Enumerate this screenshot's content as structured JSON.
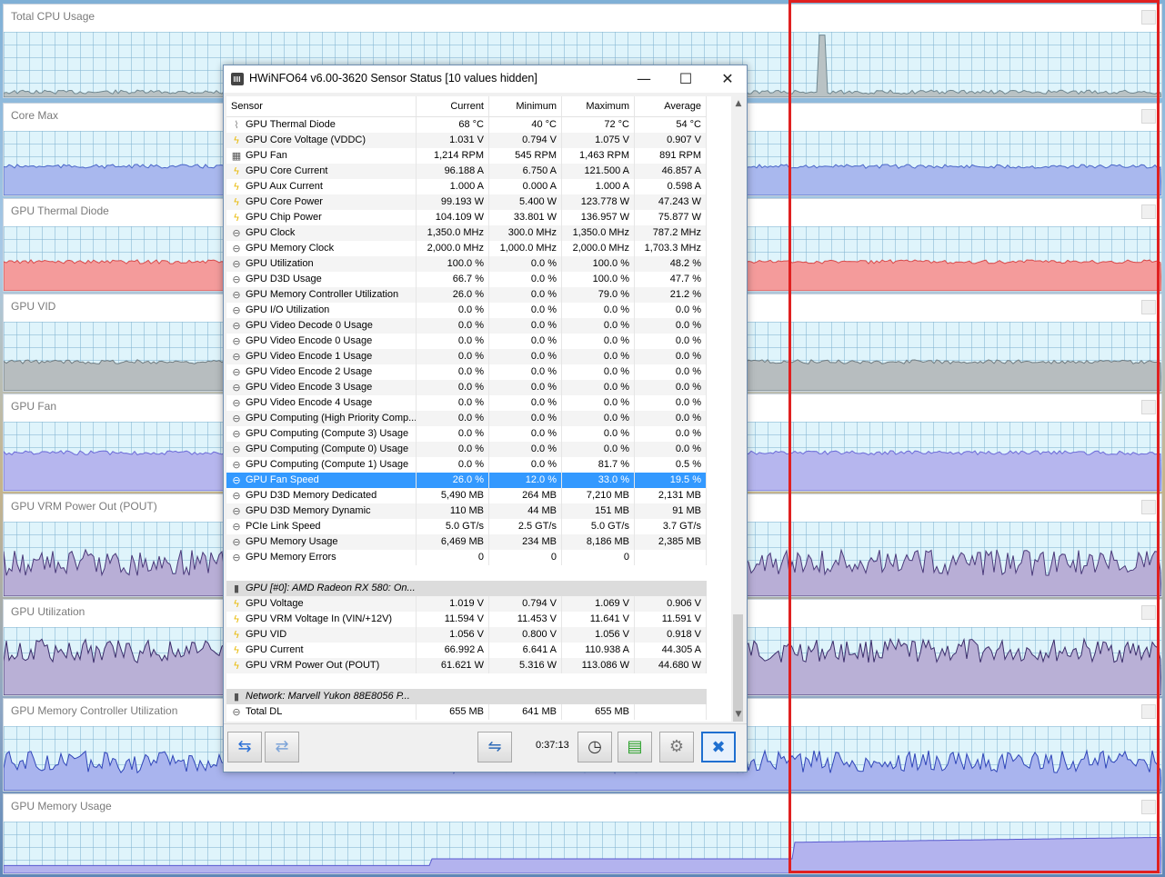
{
  "graphs": [
    {
      "title": "Total CPU Usage",
      "fill": "#b9c2c4",
      "line": "#6f8790"
    },
    {
      "title": "Core Max",
      "fill": "#a9b8ee",
      "line": "#4a67c9"
    },
    {
      "title": "GPU Thermal Diode",
      "fill": "#f49b9b",
      "line": "#d84a4a"
    },
    {
      "title": "GPU VID",
      "fill": "#b7bdbf",
      "line": "#6e7c82"
    },
    {
      "title": "GPU Fan",
      "fill": "#b6b6ee",
      "line": "#6a6ad8"
    },
    {
      "title": "GPU VRM Power Out (POUT)",
      "fill": "#b8aed6",
      "line": "#4a3a7a"
    },
    {
      "title": "GPU Utilization",
      "fill": "#b9b0d6",
      "line": "#3b2d6b"
    },
    {
      "title": "GPU Memory Controller Utilization",
      "fill": "#a9b4ee",
      "line": "#2f45b8"
    },
    {
      "title": "GPU Memory Usage",
      "fill": "#b3b3ee",
      "line": "#5a5ad0"
    }
  ],
  "window": {
    "title": "HWiNFO64 v6.00-3620 Sensor Status [10 values hidden]",
    "controls": {
      "minimize": "—",
      "maximize": "☐",
      "close": "✕"
    },
    "columns": {
      "sensor": "Sensor",
      "current": "Current",
      "minimum": "Minimum",
      "maximum": "Maximum",
      "average": "Average"
    },
    "rows": [
      {
        "icon": "thermo",
        "name": "GPU Thermal Diode",
        "cur": "68 °C",
        "min": "40 °C",
        "max": "72 °C",
        "avg": "54 °C"
      },
      {
        "icon": "bolt",
        "name": "GPU Core Voltage (VDDC)",
        "cur": "1.031 V",
        "min": "0.794 V",
        "max": "1.075 V",
        "avg": "0.907 V"
      },
      {
        "icon": "fan",
        "name": "GPU Fan",
        "cur": "1,214 RPM",
        "min": "545 RPM",
        "max": "1,463 RPM",
        "avg": "891 RPM"
      },
      {
        "icon": "bolt",
        "name": "GPU Core Current",
        "cur": "96.188 A",
        "min": "6.750 A",
        "max": "121.500 A",
        "avg": "46.857 A"
      },
      {
        "icon": "bolt",
        "name": "GPU Aux Current",
        "cur": "1.000 A",
        "min": "0.000 A",
        "max": "1.000 A",
        "avg": "0.598 A"
      },
      {
        "icon": "bolt",
        "name": "GPU Core Power",
        "cur": "99.193 W",
        "min": "5.400 W",
        "max": "123.778 W",
        "avg": "47.243 W"
      },
      {
        "icon": "bolt",
        "name": "GPU Chip Power",
        "cur": "104.109 W",
        "min": "33.801 W",
        "max": "136.957 W",
        "avg": "75.877 W"
      },
      {
        "icon": "clock",
        "name": "GPU Clock",
        "cur": "1,350.0 MHz",
        "min": "300.0 MHz",
        "max": "1,350.0 MHz",
        "avg": "787.2 MHz"
      },
      {
        "icon": "clock",
        "name": "GPU Memory Clock",
        "cur": "2,000.0 MHz",
        "min": "1,000.0 MHz",
        "max": "2,000.0 MHz",
        "avg": "1,703.3 MHz"
      },
      {
        "icon": "clock",
        "name": "GPU Utilization",
        "cur": "100.0 %",
        "min": "0.0 %",
        "max": "100.0 %",
        "avg": "48.2 %"
      },
      {
        "icon": "clock",
        "name": "GPU D3D Usage",
        "cur": "66.7 %",
        "min": "0.0 %",
        "max": "100.0 %",
        "avg": "47.7 %"
      },
      {
        "icon": "clock",
        "name": "GPU Memory Controller Utilization",
        "cur": "26.0 %",
        "min": "0.0 %",
        "max": "79.0 %",
        "avg": "21.2 %"
      },
      {
        "icon": "clock",
        "name": "GPU I/O Utilization",
        "cur": "0.0 %",
        "min": "0.0 %",
        "max": "0.0 %",
        "avg": "0.0 %"
      },
      {
        "icon": "clock",
        "name": "GPU Video Decode 0 Usage",
        "cur": "0.0 %",
        "min": "0.0 %",
        "max": "0.0 %",
        "avg": "0.0 %"
      },
      {
        "icon": "clock",
        "name": "GPU Video Encode 0 Usage",
        "cur": "0.0 %",
        "min": "0.0 %",
        "max": "0.0 %",
        "avg": "0.0 %"
      },
      {
        "icon": "clock",
        "name": "GPU Video Encode 1 Usage",
        "cur": "0.0 %",
        "min": "0.0 %",
        "max": "0.0 %",
        "avg": "0.0 %"
      },
      {
        "icon": "clock",
        "name": "GPU Video Encode 2 Usage",
        "cur": "0.0 %",
        "min": "0.0 %",
        "max": "0.0 %",
        "avg": "0.0 %"
      },
      {
        "icon": "clock",
        "name": "GPU Video Encode 3 Usage",
        "cur": "0.0 %",
        "min": "0.0 %",
        "max": "0.0 %",
        "avg": "0.0 %"
      },
      {
        "icon": "clock",
        "name": "GPU Video Encode 4 Usage",
        "cur": "0.0 %",
        "min": "0.0 %",
        "max": "0.0 %",
        "avg": "0.0 %"
      },
      {
        "icon": "clock",
        "name": "GPU Computing (High Priority Comp...",
        "cur": "0.0 %",
        "min": "0.0 %",
        "max": "0.0 %",
        "avg": "0.0 %"
      },
      {
        "icon": "clock",
        "name": "GPU Computing (Compute 3) Usage",
        "cur": "0.0 %",
        "min": "0.0 %",
        "max": "0.0 %",
        "avg": "0.0 %"
      },
      {
        "icon": "clock",
        "name": "GPU Computing (Compute 0) Usage",
        "cur": "0.0 %",
        "min": "0.0 %",
        "max": "0.0 %",
        "avg": "0.0 %"
      },
      {
        "icon": "clock",
        "name": "GPU Computing (Compute 1) Usage",
        "cur": "0.0 %",
        "min": "0.0 %",
        "max": "81.7 %",
        "avg": "0.5 %"
      },
      {
        "icon": "clock",
        "name": "GPU Fan Speed",
        "cur": "26.0 %",
        "min": "12.0 %",
        "max": "33.0 %",
        "avg": "19.5 %",
        "selected": true
      },
      {
        "icon": "clock",
        "name": "GPU D3D Memory Dedicated",
        "cur": "5,490 MB",
        "min": "264 MB",
        "max": "7,210 MB",
        "avg": "2,131 MB"
      },
      {
        "icon": "clock",
        "name": "GPU D3D Memory Dynamic",
        "cur": "110 MB",
        "min": "44 MB",
        "max": "151 MB",
        "avg": "91 MB"
      },
      {
        "icon": "clock",
        "name": "PCIe Link Speed",
        "cur": "5.0 GT/s",
        "min": "2.5 GT/s",
        "max": "5.0 GT/s",
        "avg": "3.7 GT/s"
      },
      {
        "icon": "clock",
        "name": "GPU Memory Usage",
        "cur": "6,469 MB",
        "min": "234 MB",
        "max": "8,186 MB",
        "avg": "2,385 MB"
      },
      {
        "icon": "clock",
        "name": "GPU Memory Errors",
        "cur": "0",
        "min": "0",
        "max": "0",
        "avg": ""
      },
      {
        "blank": true
      },
      {
        "icon": "chip",
        "name": "GPU [#0]: AMD Radeon RX 580: On...",
        "group": true
      },
      {
        "icon": "bolt",
        "name": "GPU Voltage",
        "cur": "1.019 V",
        "min": "0.794 V",
        "max": "1.069 V",
        "avg": "0.906 V"
      },
      {
        "icon": "bolt",
        "name": "GPU VRM Voltage In (VIN/+12V)",
        "cur": "11.594 V",
        "min": "11.453 V",
        "max": "11.641 V",
        "avg": "11.591 V"
      },
      {
        "icon": "bolt",
        "name": "GPU VID",
        "cur": "1.056 V",
        "min": "0.800 V",
        "max": "1.056 V",
        "avg": "0.918 V"
      },
      {
        "icon": "bolt",
        "name": "GPU Current",
        "cur": "66.992 A",
        "min": "6.641 A",
        "max": "110.938 A",
        "avg": "44.305 A"
      },
      {
        "icon": "bolt",
        "name": "GPU VRM Power Out (POUT)",
        "cur": "61.621 W",
        "min": "5.316 W",
        "max": "113.086 W",
        "avg": "44.680 W"
      },
      {
        "blank": true
      },
      {
        "icon": "chip",
        "name": "Network: Marvell Yukon 88E8056 P...",
        "group": true
      },
      {
        "icon": "clock",
        "name": "Total DL",
        "cur": "655 MB",
        "min": "641 MB",
        "max": "655 MB",
        "avg": ""
      }
    ],
    "toolbar": {
      "timer": "0:37:13",
      "icons": [
        "nav-arrows-icon",
        "collapse-arrows-icon",
        "network-icon",
        "clock-icon",
        "report-icon",
        "gear-icon",
        "close-icon"
      ]
    }
  }
}
